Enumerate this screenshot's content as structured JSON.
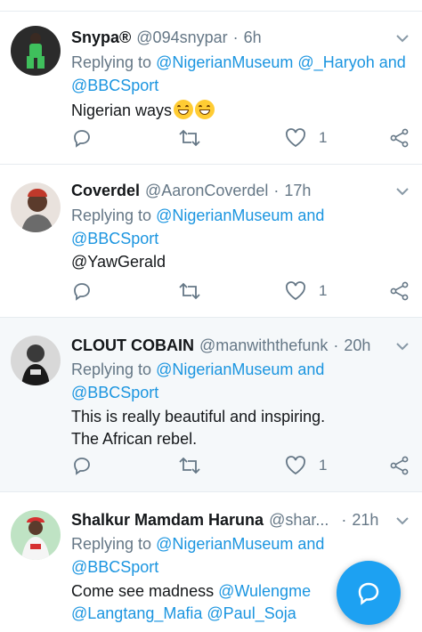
{
  "tweets": [
    {
      "name": "Snypa®",
      "handle": "@094snypar",
      "time": "6h",
      "replying_label": "Replying to",
      "replying_line1": "@NigerianMuseum @_Haryoh and",
      "replying_line2": "@BBCSport",
      "text": "Nigerian ways",
      "emoji": [
        "grinning-face",
        "grinning-face"
      ],
      "likes": "1"
    },
    {
      "name": "Coverdel",
      "handle": "@AaronCoverdel",
      "time": "17h",
      "replying_label": "Replying to",
      "replying_line1": "@NigerianMuseum and",
      "replying_line2": "@BBCSport",
      "mention": "@YawGerald",
      "likes": "1"
    },
    {
      "name": "CLOUT COBAIN",
      "handle": "@manwiththefunk",
      "time": "20h",
      "replying_label": "Replying to",
      "replying_line1": "@NigerianMuseum and",
      "replying_line2": "@BBCSport",
      "text_line1": "This is really beautiful and inspiring.",
      "text_line2": "The African rebel.",
      "likes": "1"
    },
    {
      "name": "Shalkur Mamdam Haruna",
      "handle": "@shar...",
      "time": "21h",
      "replying_label": "Replying to",
      "replying_line1": "@NigerianMuseum and",
      "replying_line2": "@BBCSport",
      "text_prefix": "Come see madness",
      "mention1": "@Wulengme",
      "mention2": "@Langtang_Mafia",
      "mention3": "@Paul_Soja"
    }
  ],
  "separator": "·",
  "colors": {
    "link": "#1b95e0",
    "muted": "#657786",
    "accent": "#1da1f2",
    "highlight_bg": "#f5f8fa"
  },
  "icons": [
    "reply-icon",
    "retweet-icon",
    "like-icon",
    "share-icon",
    "chevron-down-icon",
    "compose-reply-icon"
  ]
}
